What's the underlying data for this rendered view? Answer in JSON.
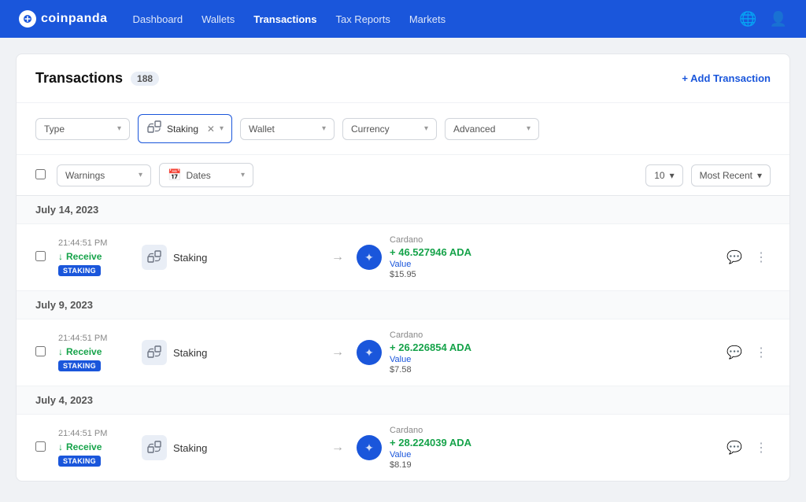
{
  "brand": {
    "name": "coinpanda"
  },
  "nav": {
    "links": [
      {
        "label": "Dashboard",
        "active": false
      },
      {
        "label": "Wallets",
        "active": false
      },
      {
        "label": "Transactions",
        "active": true
      },
      {
        "label": "Tax Reports",
        "active": false
      },
      {
        "label": "Markets",
        "active": false
      }
    ]
  },
  "page": {
    "title": "Transactions",
    "count": "188",
    "add_label": "+ Add Transaction"
  },
  "filters": {
    "type_label": "Type",
    "staking_label": "Staking",
    "wallet_label": "Wallet",
    "currency_label": "Currency",
    "advanced_label": "Advanced",
    "warnings_label": "Warnings",
    "dates_label": "Dates",
    "per_page": "10",
    "sort": "Most Recent"
  },
  "groups": [
    {
      "date": "July 14, 2023",
      "transactions": [
        {
          "time": "21:44:51 PM",
          "type": "Receive",
          "badge": "STAKING",
          "source": "Staking",
          "coin_name": "Cardano",
          "amount": "+ 46.527946 ADA",
          "value_label": "Value",
          "usd": "$15.95"
        }
      ]
    },
    {
      "date": "July 9, 2023",
      "transactions": [
        {
          "time": "21:44:51 PM",
          "type": "Receive",
          "badge": "STAKING",
          "source": "Staking",
          "coin_name": "Cardano",
          "amount": "+ 26.226854 ADA",
          "value_label": "Value",
          "usd": "$7.58"
        }
      ]
    },
    {
      "date": "July 4, 2023",
      "transactions": [
        {
          "time": "21:44:51 PM",
          "type": "Receive",
          "badge": "STAKING",
          "source": "Staking",
          "coin_name": "Cardano",
          "amount": "+ 28.224039 ADA",
          "value_label": "Value",
          "usd": "$8.19"
        }
      ]
    }
  ]
}
